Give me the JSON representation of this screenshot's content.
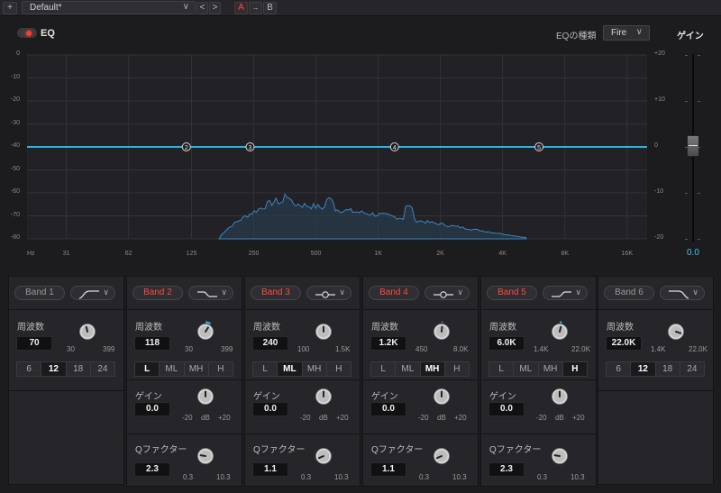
{
  "topbar": {
    "add_label": "+",
    "preset_name": "Default*",
    "chevron": "∨",
    "prev": "<",
    "next": ">",
    "a_label": "A",
    "arrow": "→",
    "b_label": "B"
  },
  "header": {
    "eq_label": "EQ",
    "eq_type_label": "EQの種類",
    "eq_type_value": "Fire",
    "gain_label": "ゲイン"
  },
  "graph": {
    "left_axis": [
      "0",
      "-10",
      "-20",
      "-30",
      "-40",
      "-50",
      "-60",
      "-70",
      "-80"
    ],
    "right_axis": [
      "+20",
      "+10",
      "0",
      "-10",
      "-20"
    ],
    "freq_axis": [
      "Hz",
      "31",
      "62",
      "125",
      "250",
      "500",
      "1K",
      "2K",
      "4K",
      "8K",
      "16K"
    ],
    "nodes": [
      {
        "label": "2",
        "freq": 118
      },
      {
        "label": "3",
        "freq": 240
      },
      {
        "label": "4",
        "freq": 1200
      },
      {
        "label": "5",
        "freq": 6000
      }
    ],
    "curve_color": "#29b6e6"
  },
  "fader": {
    "value": "0.0",
    "level_db": 0
  },
  "bands": [
    {
      "name": "Band 1",
      "active": false,
      "shape": "highpass",
      "freq_label": "周波数",
      "freq": "70",
      "freq_min": "30",
      "freq_max": "399",
      "knob": 0.45,
      "selector": [
        "6",
        "12",
        "18",
        "24"
      ],
      "selected": "12",
      "has_gain": false
    },
    {
      "name": "Band 2",
      "active": true,
      "shape": "lowshelf",
      "freq_label": "周波数",
      "freq": "118",
      "freq_min": "30",
      "freq_max": "399",
      "knob": 0.62,
      "selector": [
        "L",
        "ML",
        "MH",
        "H"
      ],
      "selected": "L",
      "has_gain": true,
      "gain_label": "ゲイン",
      "gain": "0.0",
      "gain_min": "-20",
      "gain_unit": "dB",
      "gain_max": "+20",
      "q_label": "Qファクター",
      "q": "2.3",
      "q_min": "0.3",
      "q_max": "10.3"
    },
    {
      "name": "Band 3",
      "active": true,
      "shape": "bell",
      "freq_label": "周波数",
      "freq": "240",
      "freq_min": "100",
      "freq_max": "1.5K",
      "knob": 0.5,
      "selector": [
        "L",
        "ML",
        "MH",
        "H"
      ],
      "selected": "ML",
      "has_gain": true,
      "gain_label": "ゲイン",
      "gain": "0.0",
      "gain_min": "-20",
      "gain_unit": "dB",
      "gain_max": "+20",
      "q_label": "Qファクター",
      "q": "1.1",
      "q_min": "0.3",
      "q_max": "10.3"
    },
    {
      "name": "Band 4",
      "active": true,
      "shape": "bell",
      "freq_label": "周波数",
      "freq": "1.2K",
      "freq_min": "450",
      "freq_max": "8.0K",
      "knob": 0.52,
      "selector": [
        "L",
        "ML",
        "MH",
        "H"
      ],
      "selected": "MH",
      "has_gain": true,
      "gain_label": "ゲイン",
      "gain": "0.0",
      "gain_min": "-20",
      "gain_unit": "dB",
      "gain_max": "+20",
      "q_label": "Qファクター",
      "q": "1.1",
      "q_min": "0.3",
      "q_max": "10.3"
    },
    {
      "name": "Band 5",
      "active": true,
      "shape": "highshelf",
      "freq_label": "周波数",
      "freq": "6.0K",
      "freq_min": "1.4K",
      "freq_max": "22.0K",
      "knob": 0.55,
      "selector": [
        "L",
        "ML",
        "MH",
        "H"
      ],
      "selected": "H",
      "has_gain": true,
      "gain_label": "ゲイン",
      "gain": "0.0",
      "gain_min": "-20",
      "gain_unit": "dB",
      "gain_max": "+20",
      "q_label": "Qファクター",
      "q": "2.3",
      "q_min": "0.3",
      "q_max": "10.3"
    },
    {
      "name": "Band 6",
      "active": false,
      "shape": "lowpass",
      "freq_label": "周波数",
      "freq": "22.0K",
      "freq_min": "1.4K",
      "freq_max": "22.0K",
      "knob": 0.9,
      "selector": [
        "6",
        "12",
        "18",
        "24"
      ],
      "selected": "12",
      "has_gain": false
    }
  ]
}
